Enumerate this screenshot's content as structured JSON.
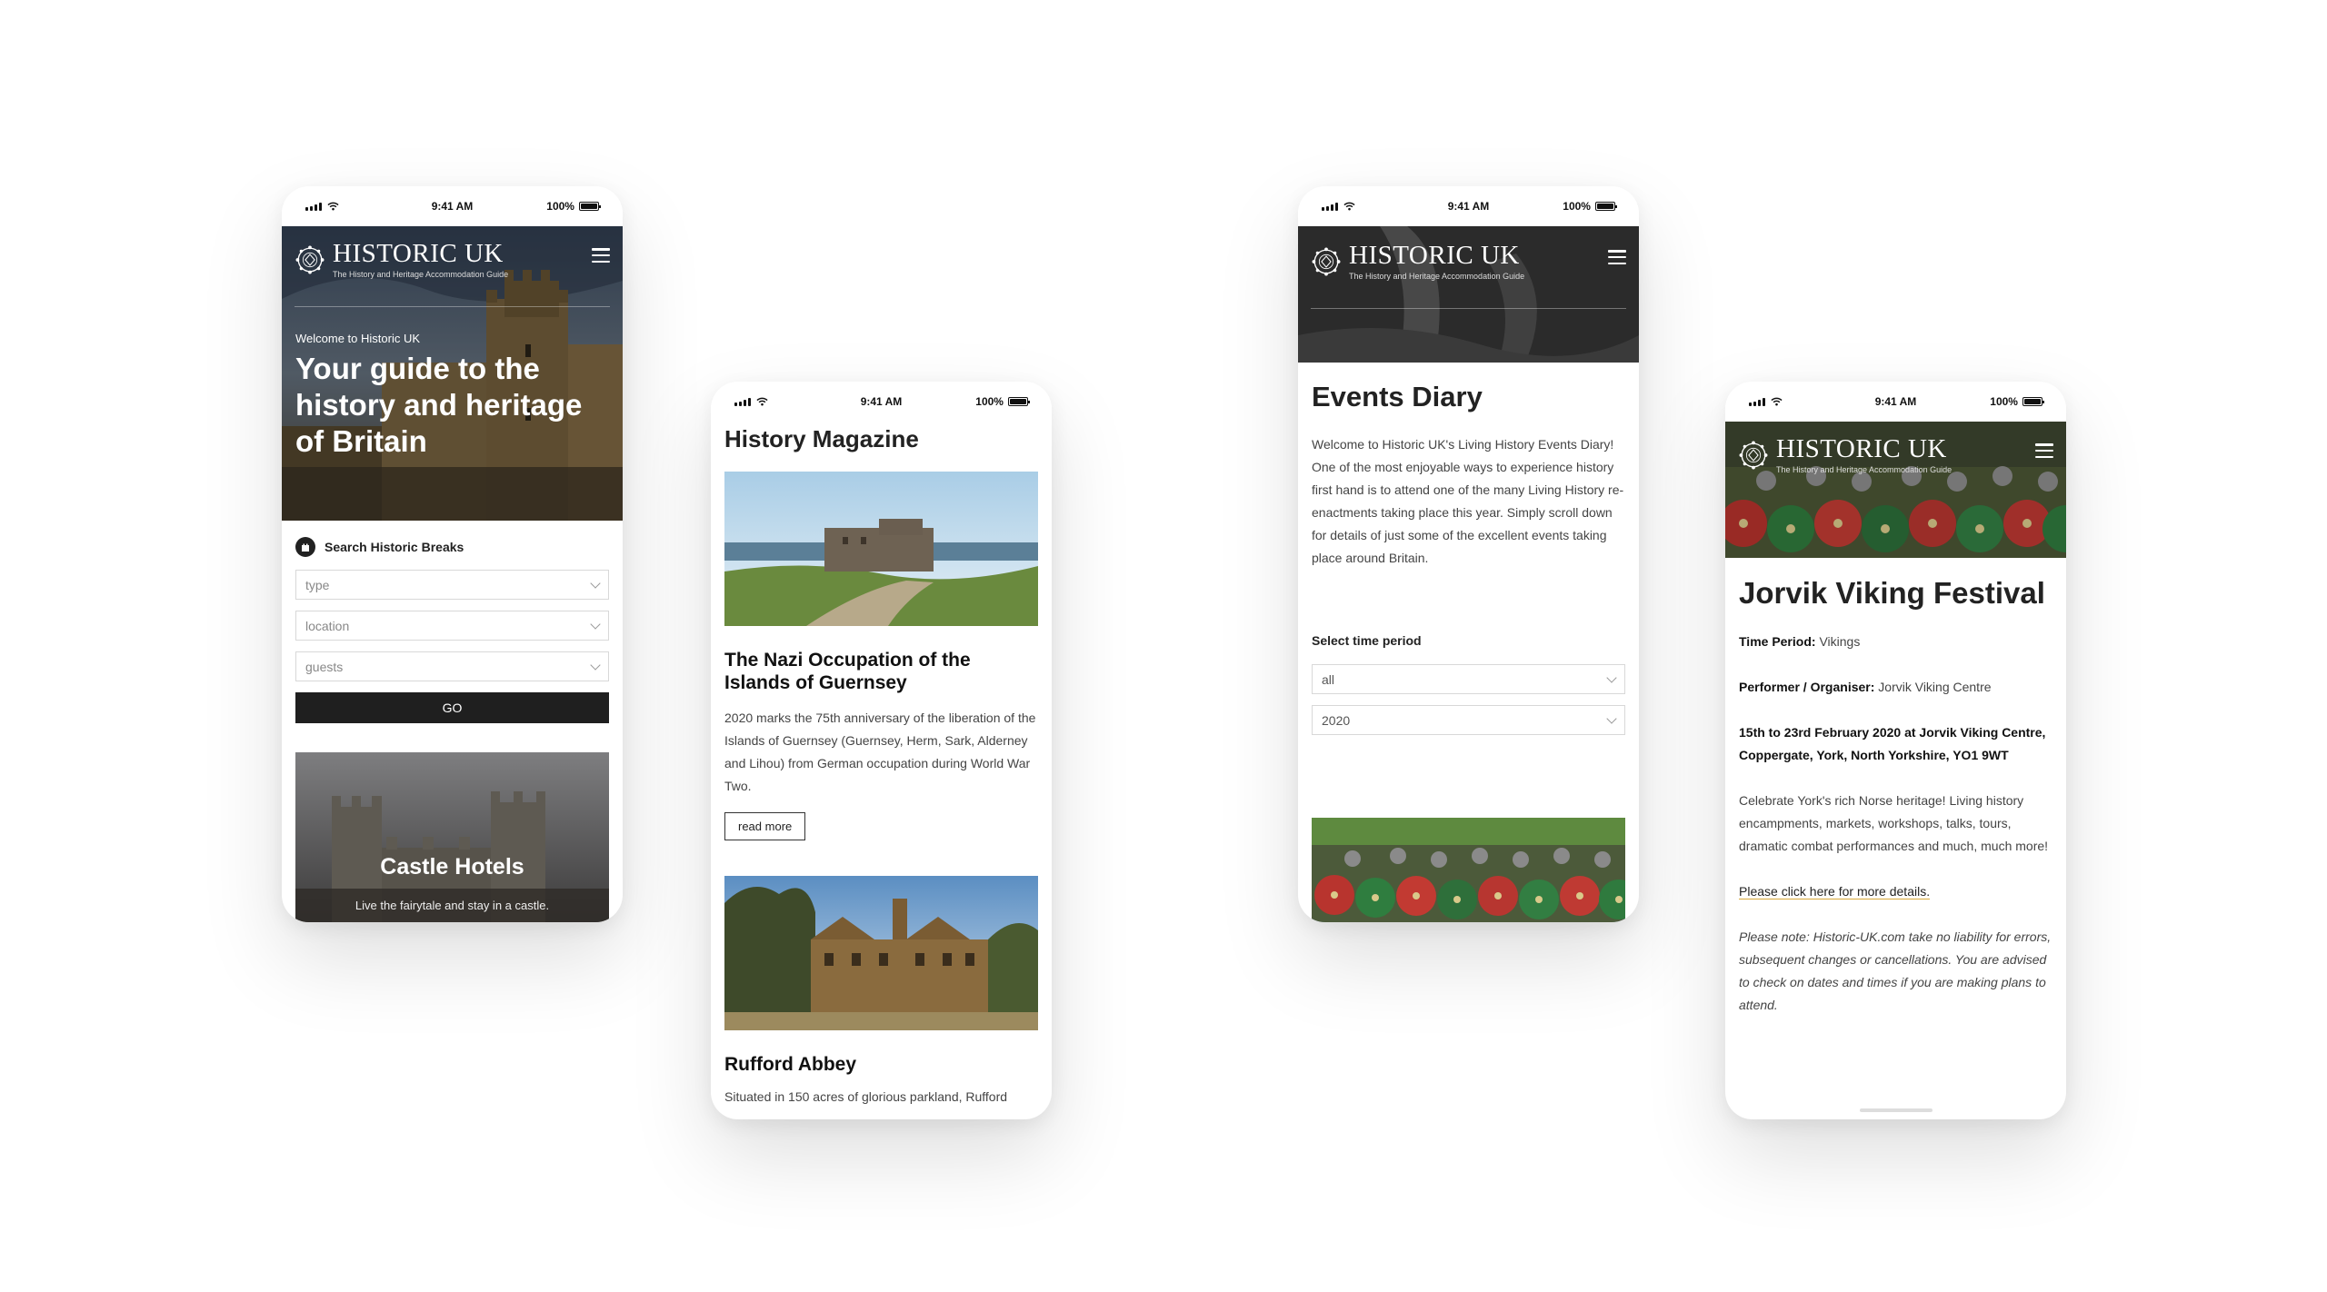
{
  "status": {
    "time": "9:41 AM",
    "battery": "100%"
  },
  "brand": {
    "name": "HISTORIC UK",
    "tagline": "The History and Heritage Accommodation Guide"
  },
  "home": {
    "welcome": "Welcome to Historic UK",
    "headline": "Your guide to the history and heritage of Britain",
    "search": {
      "title": "Search Historic Breaks",
      "type_placeholder": "type",
      "location_placeholder": "location",
      "guests_placeholder": "guests",
      "go_label": "GO"
    },
    "promo": {
      "title": "Castle Hotels",
      "subtitle": "Live the fairytale and stay in a castle."
    }
  },
  "magazine": {
    "title": "History Magazine",
    "articles": [
      {
        "title": "The Nazi Occupation of the Islands of Guernsey",
        "text": "2020 marks the 75th anniversary of the liberation of the Islands of Guernsey (Guernsey, Herm, Sark, Alderney and Lihou) from German occupation during World War Two.",
        "button": "read more"
      },
      {
        "title": "Rufford Abbey",
        "text": "Situated in 150 acres of glorious parkland, Rufford"
      }
    ]
  },
  "events": {
    "title": "Events Diary",
    "intro": "Welcome to Historic UK's Living History Events Diary! One of the most enjoyable ways to experience history first hand is to attend one of the many Living History re-enactments taking place this year. Simply scroll down for details of just some of the excellent events taking place around Britain.",
    "filter_label": "Select time period",
    "period_value": "all",
    "year_value": "2020"
  },
  "event_detail": {
    "title": "Jorvik Viking Festival",
    "period_label": "Time Period:",
    "period_value": "Vikings",
    "organiser_label": "Performer / Organiser:",
    "organiser_value": "Jorvik Viking Centre",
    "when_where": "15th to 23rd February 2020 at Jorvik Viking Centre, Coppergate, York, North Yorkshire, YO1 9WT",
    "description": "Celebrate York's rich Norse heritage! Living history encampments, markets, workshops, talks, tours, dramatic combat performances and much, much more!",
    "link": "Please click here for more details.",
    "note": "Please note: Historic-UK.com take no liability for errors, subsequent changes or cancellations. You are advised to check on dates and times if you are making plans to attend."
  }
}
